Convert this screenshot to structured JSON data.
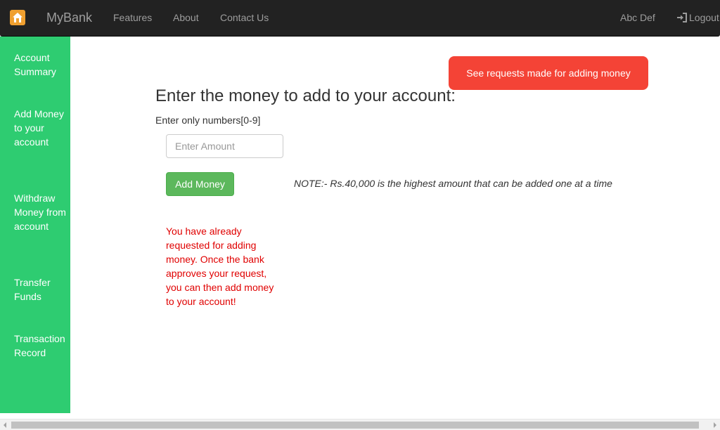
{
  "navbar": {
    "brand": "MyBank",
    "brand_icon": "home-icon",
    "links": [
      "Features",
      "About",
      "Contact Us"
    ],
    "user_name": "Abc Def",
    "logout_label": "Logout",
    "logout_icon": "log-in-icon",
    "background": "#222222",
    "link_color": "#9d9d9d"
  },
  "sidebar": {
    "background": "#2ecc71",
    "items": [
      {
        "label": "Account Summary"
      },
      {
        "label": "Add Money to your account"
      },
      {
        "label": "Withdraw Money from account"
      },
      {
        "label": "Transfer Funds"
      },
      {
        "label": "Transaction Record"
      }
    ]
  },
  "main": {
    "requests_button": "See requests made for adding money",
    "requests_button_color": "#f44336",
    "heading": "Enter the money to add to your account:",
    "hint": "Enter only numbers[0-9]",
    "amount_input": {
      "value": "",
      "placeholder": "Enter Amount"
    },
    "add_button": "Add Money",
    "add_button_color": "#5cb85c",
    "note": "NOTE:- Rs.40,000 is the highest amount that can be added one at a time",
    "warning": "You have already requested for adding money. Once the bank approves your request, you can then add money to your account!",
    "warning_color": "#e00000"
  }
}
